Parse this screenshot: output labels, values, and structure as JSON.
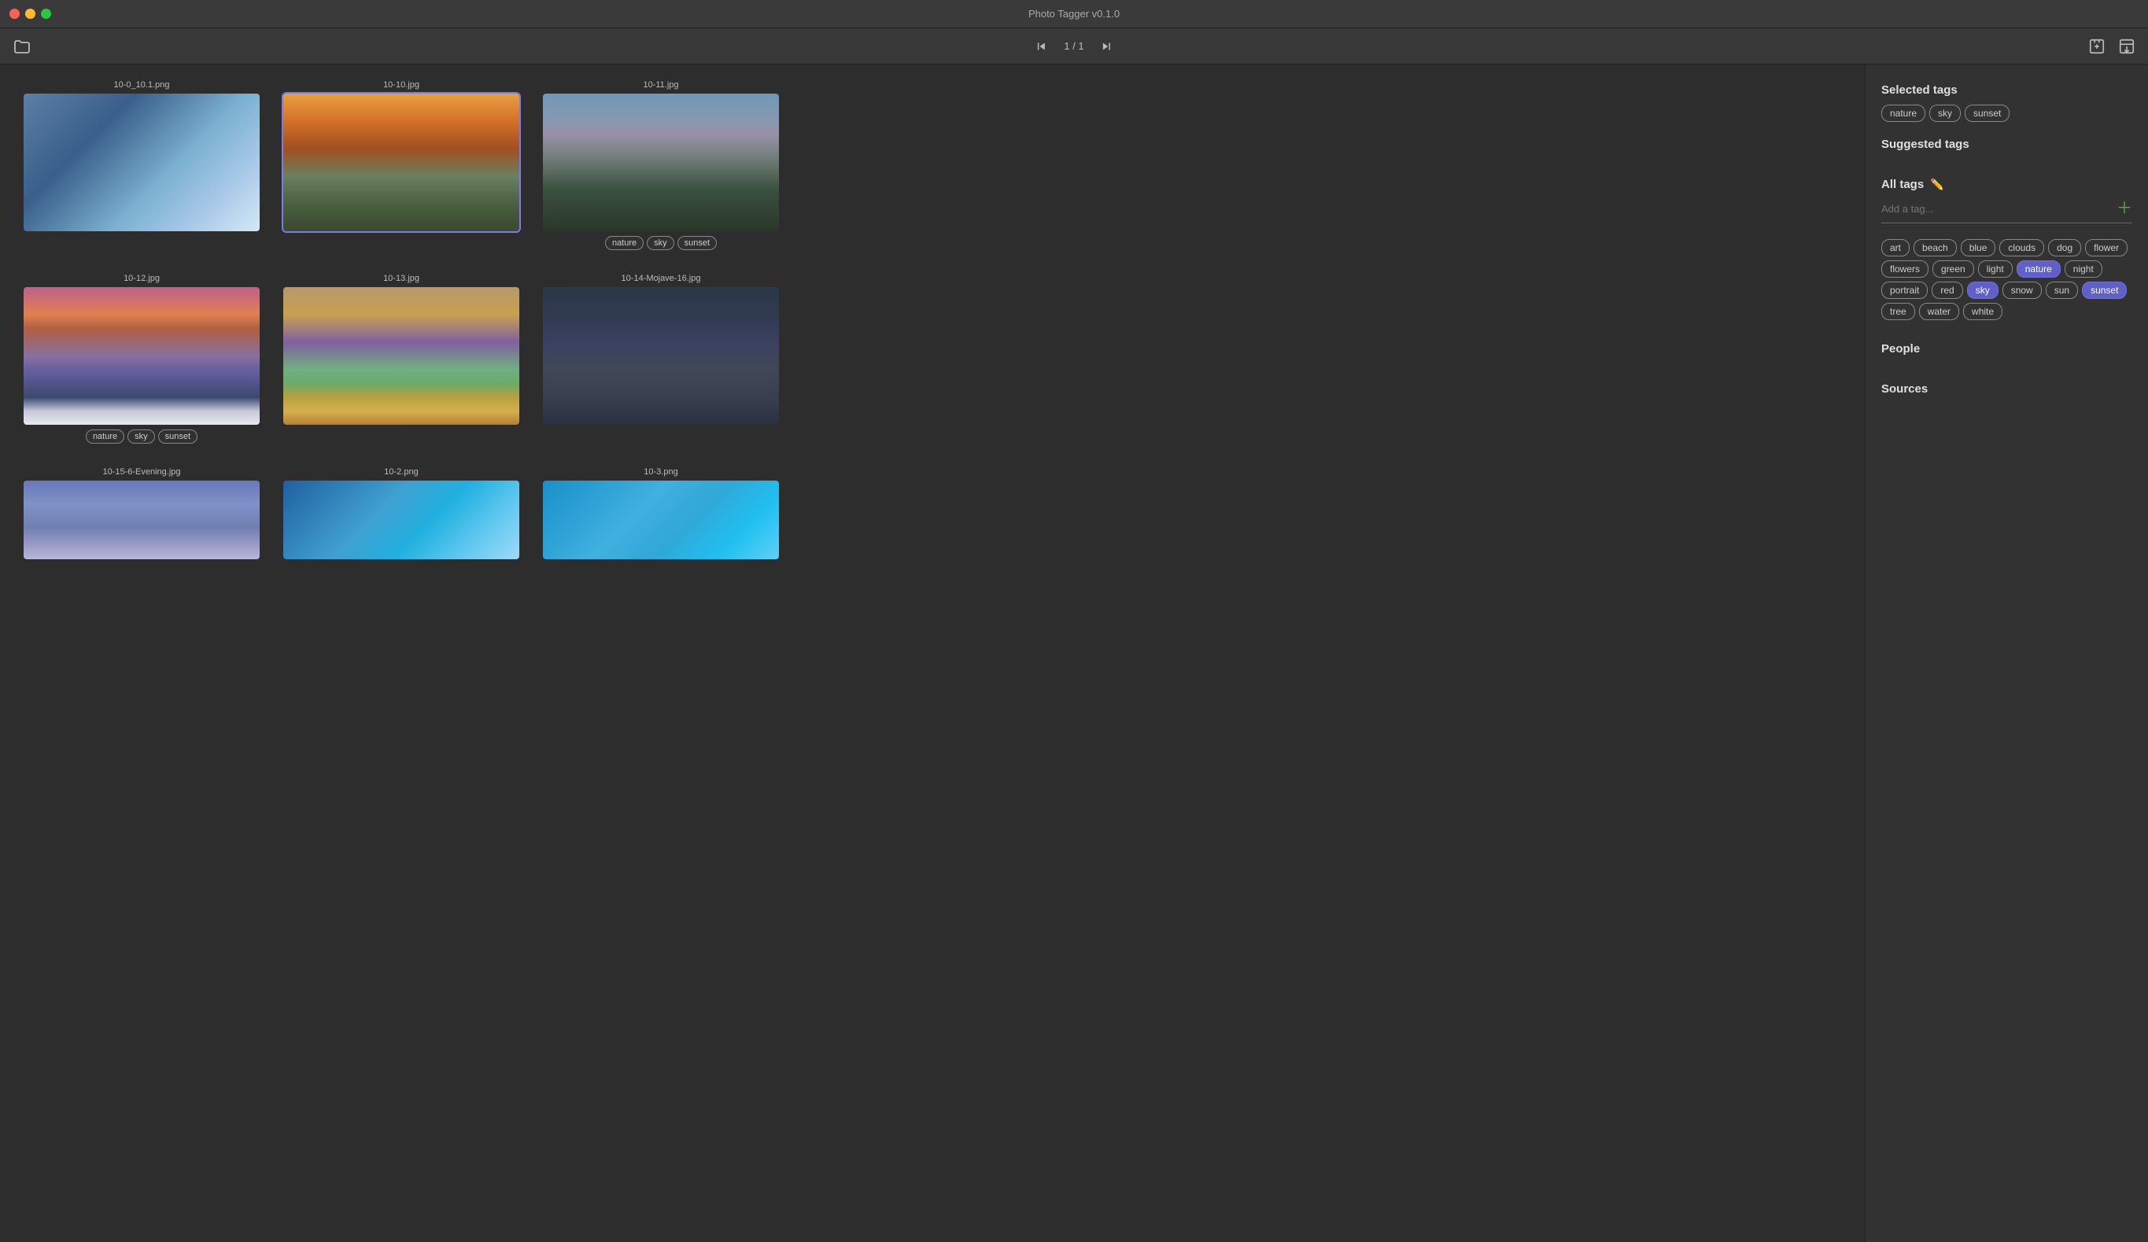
{
  "app": {
    "title": "Photo Tagger v0.1.0"
  },
  "titlebar": {
    "traffic_lights": [
      "close",
      "minimize",
      "maximize"
    ]
  },
  "toolbar": {
    "folder_label": "Open Folder",
    "prev_label": "⏮",
    "next_label": "⏭",
    "page_indicator": "1 / 1",
    "import_label": "Import",
    "export_label": "Export"
  },
  "photos": [
    {
      "filename": "10-0_10.1.png",
      "style": "blue-abstract",
      "selected": false,
      "tags": []
    },
    {
      "filename": "10-10.jpg",
      "style": "yosemite-sunset",
      "selected": true,
      "tags": []
    },
    {
      "filename": "10-11.jpg",
      "style": "yosemite-dusk",
      "selected": false,
      "tags": [
        "nature",
        "sky",
        "sunset"
      ]
    },
    {
      "filename": "10-12.jpg",
      "style": "mountain-sunset",
      "selected": false,
      "tags": [
        "nature",
        "sky",
        "sunset"
      ]
    },
    {
      "filename": "10-13.jpg",
      "style": "sierra-autumn",
      "selected": false,
      "tags": []
    },
    {
      "filename": "10-14-Mojave-16.jpg",
      "style": "mojave-dunes",
      "selected": false,
      "tags": []
    },
    {
      "filename": "10-15-6-Evening.jpg",
      "style": "evening-sky",
      "selected": false,
      "tags": []
    },
    {
      "filename": "10-2.png",
      "style": "blue-wave",
      "selected": false,
      "tags": []
    },
    {
      "filename": "10-3.png",
      "style": "blue-water",
      "selected": false,
      "tags": []
    }
  ],
  "sidebar": {
    "selected_tags_title": "Selected tags",
    "selected_tags": [
      "nature",
      "sky",
      "sunset"
    ],
    "suggested_tags_title": "Suggested tags",
    "all_tags_title": "All tags",
    "add_tag_placeholder": "Add a tag...",
    "all_tags": [
      {
        "label": "art",
        "active": false
      },
      {
        "label": "beach",
        "active": false
      },
      {
        "label": "blue",
        "active": false
      },
      {
        "label": "clouds",
        "active": false
      },
      {
        "label": "dog",
        "active": false
      },
      {
        "label": "flower",
        "active": false
      },
      {
        "label": "flowers",
        "active": false
      },
      {
        "label": "green",
        "active": false
      },
      {
        "label": "light",
        "active": false
      },
      {
        "label": "nature",
        "active": true
      },
      {
        "label": "night",
        "active": false
      },
      {
        "label": "portrait",
        "active": false
      },
      {
        "label": "red",
        "active": false
      },
      {
        "label": "sky",
        "active": true
      },
      {
        "label": "snow",
        "active": false
      },
      {
        "label": "sun",
        "active": false
      },
      {
        "label": "sunset",
        "active": true
      },
      {
        "label": "tree",
        "active": false
      },
      {
        "label": "water",
        "active": false
      },
      {
        "label": "white",
        "active": false
      }
    ],
    "people_title": "People",
    "sources_title": "Sources"
  }
}
